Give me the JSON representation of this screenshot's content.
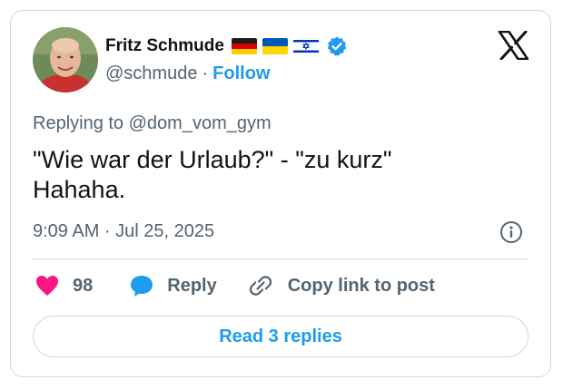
{
  "author": {
    "display_name": "Fritz Schmude",
    "handle": "@schmude",
    "separator": "·",
    "follow_label": "Follow",
    "flags": [
      "germany-flag",
      "ukraine-flag",
      "israel-flag"
    ],
    "verified": true
  },
  "tweet": {
    "replying_to": "Replying to @dom_vom_gym",
    "text": "\"Wie war der Urlaub?\" - \"zu kurz\"\nHahaha.",
    "timestamp": "9:09 AM · Jul 25, 2025"
  },
  "actions": {
    "like_count": "98",
    "reply_label": "Reply",
    "copy_label": "Copy link to post"
  },
  "read_replies_label": "Read 3 replies",
  "colors": {
    "accent": "#1d9bf0",
    "like": "#f91880",
    "text_primary": "#0f1419",
    "text_secondary": "#536471",
    "border": "#cfd9de"
  }
}
